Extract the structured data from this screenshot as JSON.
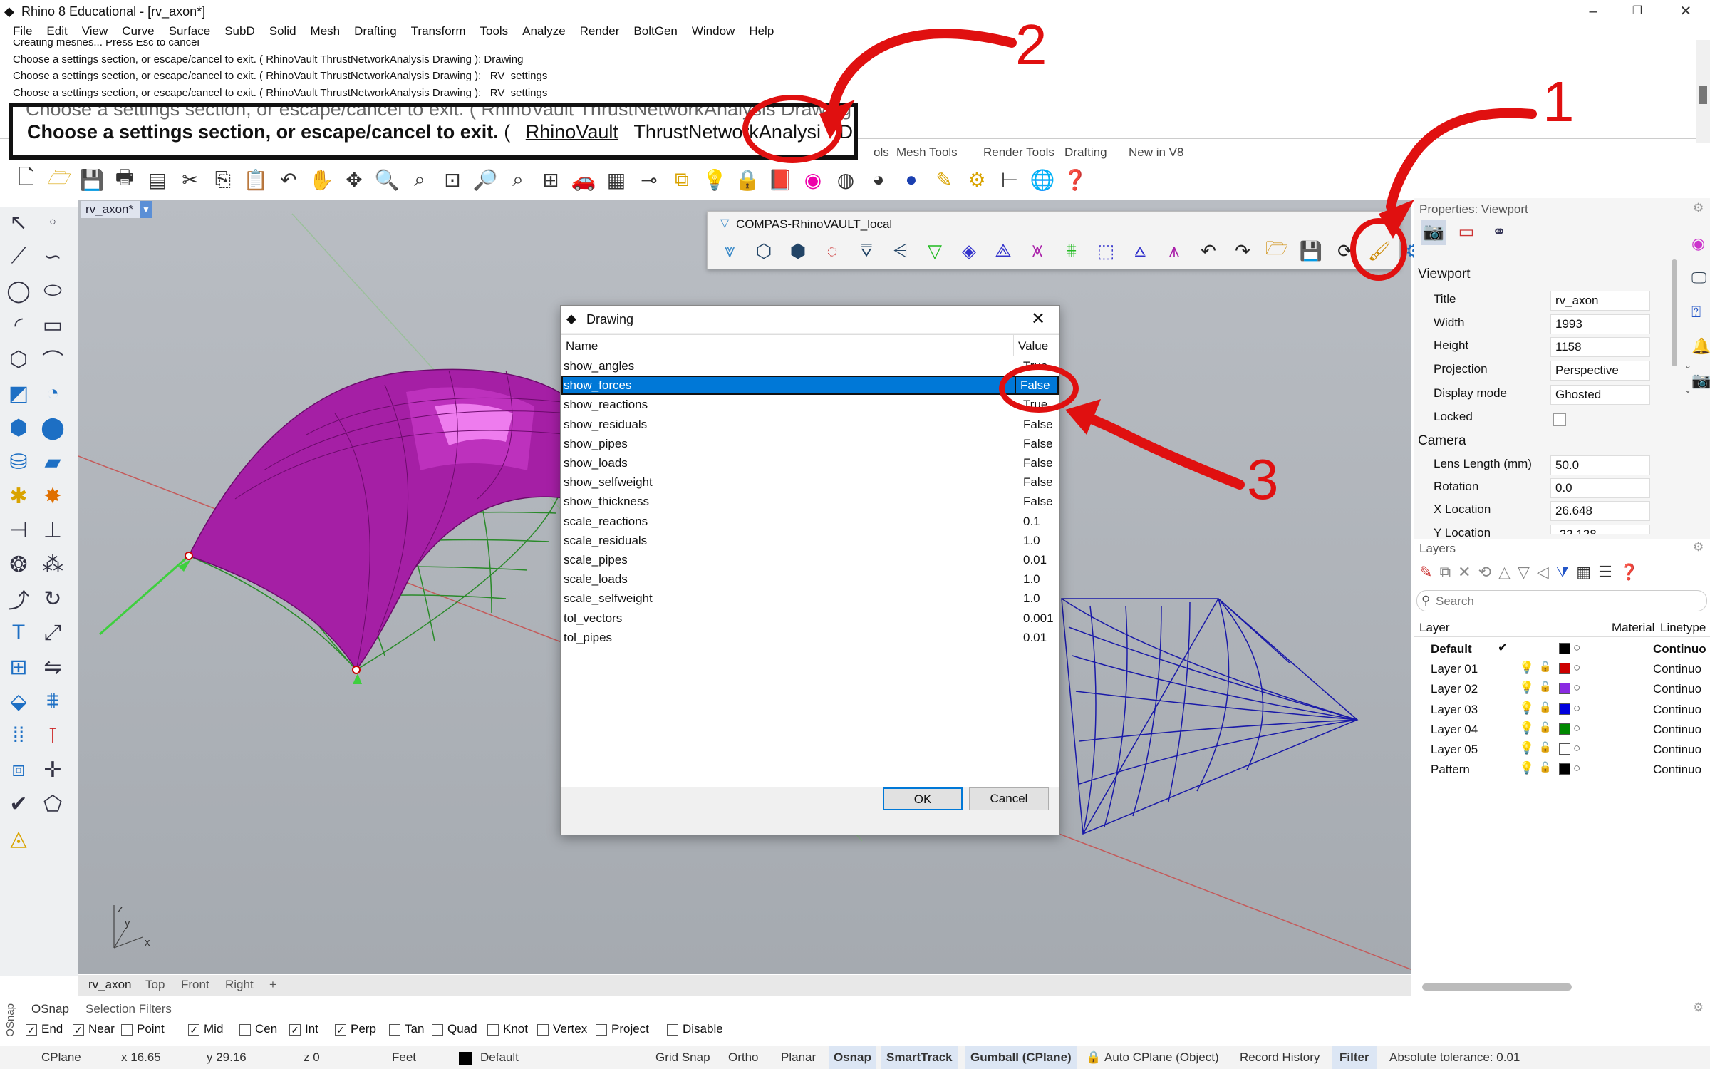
{
  "window": {
    "title": "Rhino 8 Educational - [rv_axon*]",
    "minimize": "–",
    "maximize": "❐",
    "close": "✕"
  },
  "menu": [
    "File",
    "Edit",
    "View",
    "Curve",
    "Surface",
    "SubD",
    "Solid",
    "Mesh",
    "Drafting",
    "Transform",
    "Tools",
    "Analyze",
    "Render",
    "BoltGen",
    "Window",
    "Help"
  ],
  "command_history": [
    "Creating meshes... Press Esc to cancel",
    "Choose a settings section, or escape/cancel to exit. ( RhinoVault  ThrustNetworkAnalysis  Drawing ): Drawing",
    "Choose a settings section, or escape/cancel to exit. ( RhinoVault  ThrustNetworkAnalysis  Drawing ): _RV_settings",
    "Choose a settings section, or escape/cancel to exit. ( RhinoVault  ThrustNetworkAnalysis  Drawing ): _RV_settings"
  ],
  "zoom_prompt": {
    "ghost": "Choose a settings section, or escape/cancel to exit. ( RhinoVault  ThrustNetworkAnalysis  Drawing ): _RV_s",
    "text": "Choose a settings section, or escape/cancel to exit.",
    "open_paren": "(",
    "options": [
      "RhinoVault",
      "ThrustNetworkAnalysi",
      "Drawing"
    ],
    "close_paren": ")"
  },
  "toolbar_tabs": [
    "ols",
    "Mesh Tools",
    "Render Tools",
    "Drafting",
    "New in V8"
  ],
  "viewport": {
    "name": "rv_axon*",
    "axis_x": "x",
    "axis_y": "y",
    "axis_z": "z"
  },
  "view_tabs": [
    "rv_axon",
    "Top",
    "Front",
    "Right",
    "+"
  ],
  "rv_toolbar": {
    "title": "COMPAS-RhinoVAULT_local"
  },
  "dialog": {
    "title": "Drawing",
    "col_name": "Name",
    "col_value": "Value",
    "rows": [
      {
        "name": "show_angles",
        "value": "True"
      },
      {
        "name": "show_forces",
        "value": "False"
      },
      {
        "name": "show_reactions",
        "value": "True"
      },
      {
        "name": "show_residuals",
        "value": "False"
      },
      {
        "name": "show_pipes",
        "value": "False"
      },
      {
        "name": "show_loads",
        "value": "False"
      },
      {
        "name": "show_selfweight",
        "value": "False"
      },
      {
        "name": "show_thickness",
        "value": "False"
      },
      {
        "name": "scale_reactions",
        "value": "0.1"
      },
      {
        "name": "scale_residuals",
        "value": "1.0"
      },
      {
        "name": "scale_pipes",
        "value": "0.01"
      },
      {
        "name": "scale_loads",
        "value": "1.0"
      },
      {
        "name": "scale_selfweight",
        "value": "1.0"
      },
      {
        "name": "tol_vectors",
        "value": "0.001"
      },
      {
        "name": "tol_pipes",
        "value": "0.01"
      }
    ],
    "ok": "OK",
    "cancel": "Cancel"
  },
  "properties": {
    "header": "Properties: Viewport",
    "section_viewport": "Viewport",
    "title_label": "Title",
    "title_value": "rv_axon",
    "width_label": "Width",
    "width_value": "1993",
    "height_label": "Height",
    "height_value": "1158",
    "projection_label": "Projection",
    "projection_value": "Perspective",
    "display_label": "Display mode",
    "display_value": "Ghosted",
    "locked_label": "Locked",
    "section_camera": "Camera",
    "lens_label": "Lens Length (mm)",
    "lens_value": "50.0",
    "rotation_label": "Rotation",
    "rotation_value": "0.0",
    "xloc_label": "X Location",
    "xloc_value": "26.648",
    "yloc_label": "Y Location",
    "yloc_value": "-22.128"
  },
  "layers": {
    "header": "Layers",
    "search_placeholder": "Search",
    "col_layer": "Layer",
    "col_material": "Material",
    "col_linetype": "Linetype",
    "rows": [
      {
        "name": "Default",
        "color": "#000000",
        "linetype": "Continuo",
        "current": true
      },
      {
        "name": "Layer 01",
        "color": "#cc0000",
        "linetype": "Continuo"
      },
      {
        "name": "Layer 02",
        "color": "#8a2be2",
        "linetype": "Continuo"
      },
      {
        "name": "Layer 03",
        "color": "#0000dd",
        "linetype": "Continuo"
      },
      {
        "name": "Layer 04",
        "color": "#008800",
        "linetype": "Continuo"
      },
      {
        "name": "Layer 05",
        "color": "#ffffff",
        "linetype": "Continuo"
      },
      {
        "name": "Pattern",
        "color": "#000000",
        "linetype": "Continuo"
      }
    ]
  },
  "osnap": {
    "tab_osnap": "OSnap",
    "tab_filters": "Selection Filters",
    "side_label": "OSnap",
    "items": [
      {
        "label": "End",
        "checked": true
      },
      {
        "label": "Near",
        "checked": true
      },
      {
        "label": "Point",
        "checked": false
      },
      {
        "label": "Mid",
        "checked": true
      },
      {
        "label": "Cen",
        "checked": false
      },
      {
        "label": "Int",
        "checked": true
      },
      {
        "label": "Perp",
        "checked": true
      },
      {
        "label": "Tan",
        "checked": false
      },
      {
        "label": "Quad",
        "checked": false
      },
      {
        "label": "Knot",
        "checked": false
      },
      {
        "label": "Vertex",
        "checked": false
      },
      {
        "label": "Project",
        "checked": false
      },
      {
        "label": "Disable",
        "checked": false
      }
    ]
  },
  "status": {
    "cplane": "CPlane",
    "x": "x 16.65",
    "y": "y 29.16",
    "z": "z 0",
    "units": "Feet",
    "layer": "Default",
    "grid_snap": "Grid Snap",
    "ortho": "Ortho",
    "planar": "Planar",
    "osnap": "Osnap",
    "smarttrack": "SmartTrack",
    "gumball": "Gumball (CPlane)",
    "auto_cplane": "Auto CPlane (Object)",
    "record_history": "Record History",
    "filter": "Filter",
    "tolerance": "Absolute tolerance: 0.01"
  },
  "annotations": {
    "n1": "1",
    "n2": "2",
    "n3": "3"
  }
}
